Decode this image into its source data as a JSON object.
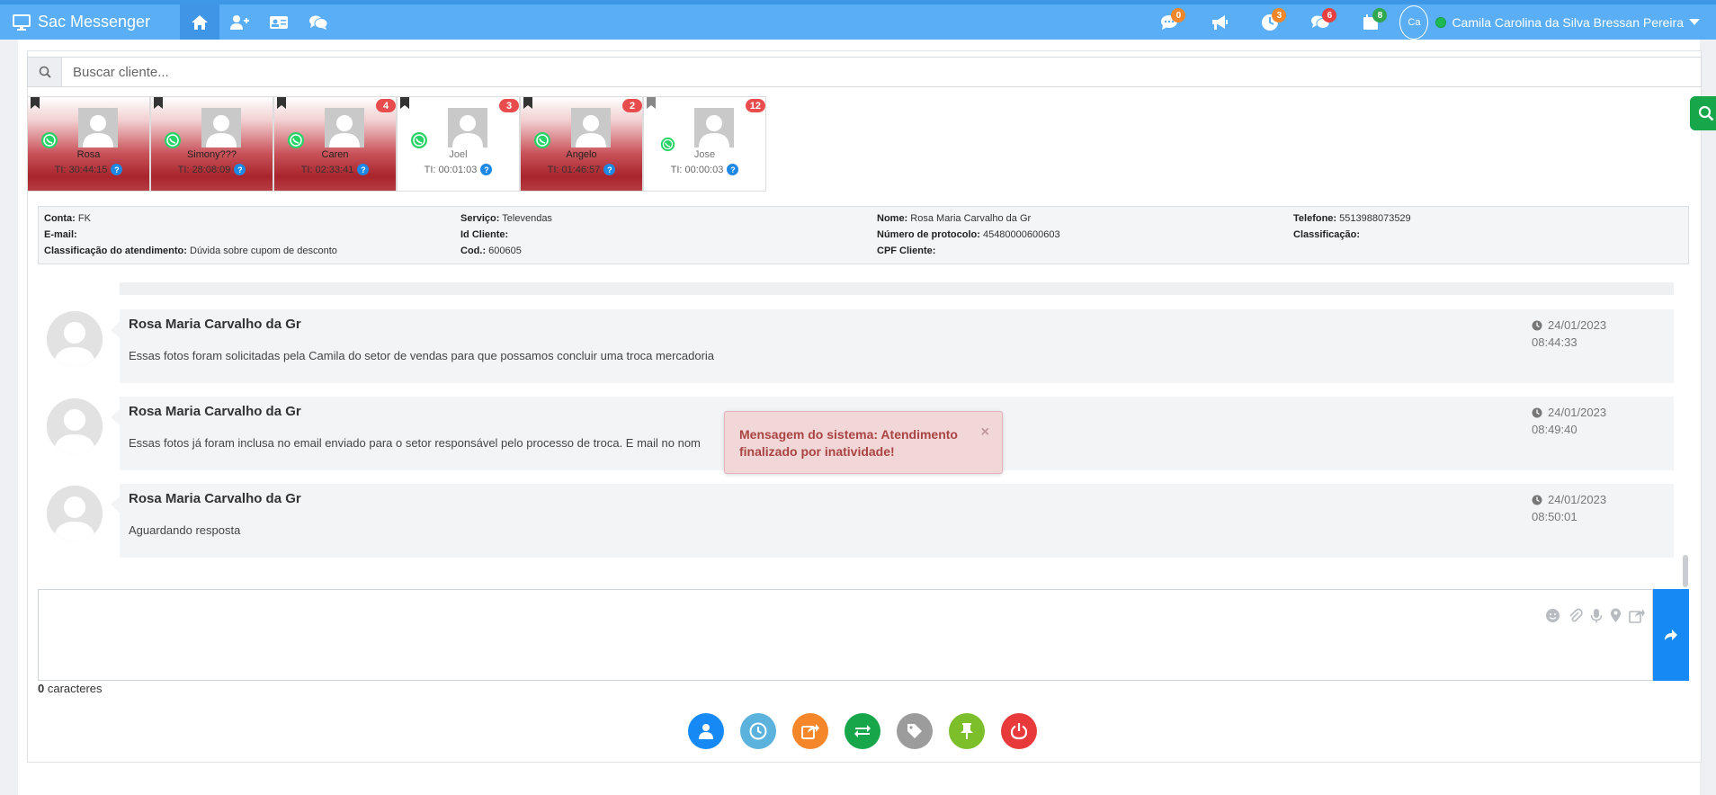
{
  "app": {
    "title": "Sac Messenger"
  },
  "nav": {
    "badges": [
      {
        "icon": "chat-bubble-icon",
        "count": "0",
        "color": "#f0872a"
      },
      {
        "icon": "megaphone-icon",
        "count": "",
        "color": ""
      },
      {
        "icon": "clock-icon",
        "count": "3",
        "color": "#f0872a"
      },
      {
        "icon": "chats-icon",
        "count": "6",
        "color": "#e84040"
      },
      {
        "icon": "calendar-icon",
        "count": "8",
        "color": "#2fa84f"
      }
    ],
    "avatar_alt": "Ca",
    "user_name": "Camila Carolina da Silva Bressan Pereira"
  },
  "search": {
    "placeholder": "Buscar cliente..."
  },
  "clients": [
    {
      "name": "Rosa",
      "time": "TI: 30:44:15",
      "badge": "",
      "state": "red"
    },
    {
      "name": "Simony???",
      "time": "TI: 28:08:09",
      "badge": "",
      "state": "red"
    },
    {
      "name": "Caren",
      "time": "TI: 02:33:41",
      "badge": "4",
      "state": "red"
    },
    {
      "name": "Joel",
      "time": "TI: 00:01:03",
      "badge": "3",
      "state": "white"
    },
    {
      "name": "Angelo",
      "time": "TI: 01:46:57",
      "badge": "2",
      "state": "red"
    },
    {
      "name": "Jose",
      "time": "TI: 00:00:03",
      "badge": "12",
      "state": "white"
    }
  ],
  "info": {
    "conta_label": "Conta:",
    "conta": "FK",
    "email_label": "E-mail:",
    "email": "",
    "classif_atend_label": "Classificação do atendimento:",
    "classif_atend": "Dúvida sobre cupom de desconto",
    "servico_label": "Serviço:",
    "servico": "Televendas",
    "id_cliente_label": "Id Cliente:",
    "id_cliente": "",
    "cod_label": "Cod.:",
    "cod": "600605",
    "nome_label": "Nome:",
    "nome": "Rosa Maria Carvalho da Gr",
    "protocolo_label": "Número de protocolo:",
    "protocolo": "45480000600603",
    "cpf_label": "CPF Cliente:",
    "cpf": "",
    "telefone_label": "Telefone:",
    "telefone": "5513988073529",
    "classificacao_label": "Classificação:",
    "classificacao": ""
  },
  "messages": [
    {
      "sender": "Rosa Maria Carvalho da Gr",
      "text": "Essas fotos foram solicitadas pela Camila do setor de vendas para que possamos concluir uma troca mercadoria",
      "date": "24/01/2023",
      "time": "08:44:33"
    },
    {
      "sender": "Rosa Maria Carvalho da Gr",
      "text": "Essas fotos já foram inclusa no email enviado para o setor responsável pelo processo de troca. E mail no nom",
      "date": "24/01/2023",
      "time": "08:49:40"
    },
    {
      "sender": "Rosa Maria Carvalho da Gr",
      "text": "Aguardando resposta",
      "date": "24/01/2023",
      "time": "08:50:01"
    }
  ],
  "toast": {
    "text": "Mensagem do sistema: Atendimento finalizado por inatividade!",
    "close": "×"
  },
  "composer": {
    "count": "0",
    "count_label": " caracteres"
  },
  "actions": [
    {
      "name": "client-info-button",
      "icon": "user-icon",
      "color": "#1689f5"
    },
    {
      "name": "history-button",
      "icon": "clock-icon",
      "color": "#5bb2dd"
    },
    {
      "name": "share-button",
      "icon": "share-icon",
      "color": "#f5862a"
    },
    {
      "name": "transfer-button",
      "icon": "transfer-icon",
      "color": "#17a64a"
    },
    {
      "name": "tag-button",
      "icon": "tag-icon",
      "color": "#9c9c9c"
    },
    {
      "name": "pin-button",
      "icon": "pin-icon",
      "color": "#7cbf2a"
    },
    {
      "name": "end-chat-button",
      "icon": "power-icon",
      "color": "#e83a3a"
    }
  ]
}
